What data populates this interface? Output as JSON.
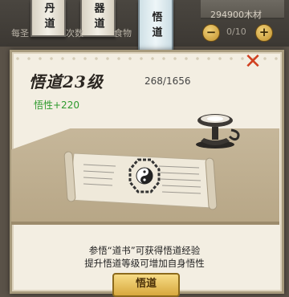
{
  "tabs": [
    {
      "label": "丹道",
      "active": false
    },
    {
      "label": "器道",
      "active": false
    },
    {
      "label": "悟道",
      "active": true
    }
  ],
  "background_labels": [
    "每圣",
    "次数",
    "食物"
  ],
  "resource": {
    "text": "294900木材"
  },
  "counter": {
    "text": "0/10",
    "minus": "−",
    "plus": "+"
  },
  "panel": {
    "title": "悟道23级",
    "progress": "268/1656",
    "attribute": "悟性+220",
    "close_symbol": "✕",
    "description_line1": "参悟“道书”可获得悟道经验",
    "description_line2": "提升悟道等级可增加自身悟性",
    "action_label": "悟道"
  },
  "colors": {
    "accent": "#d04020",
    "attribute": "#2e9a2e",
    "button": "#e6c066"
  }
}
